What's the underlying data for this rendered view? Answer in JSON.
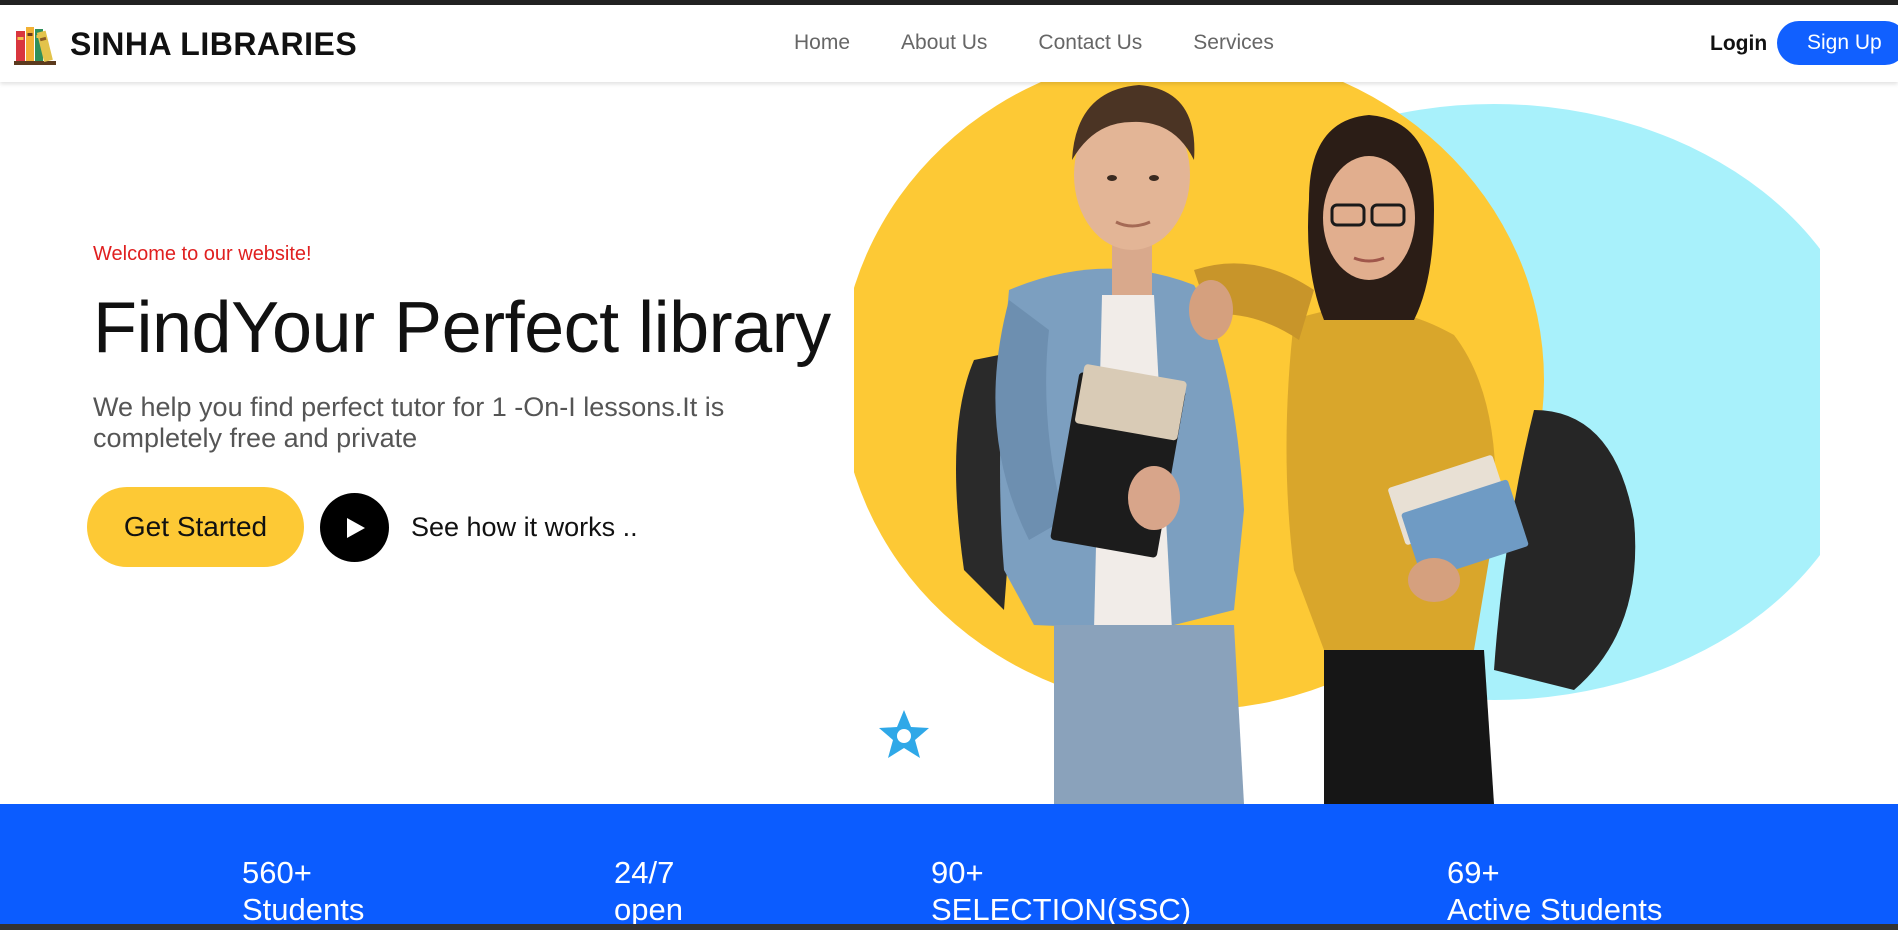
{
  "brand": {
    "name": "SINHA LIBRARIES",
    "logo_icon": "books-icon"
  },
  "nav": {
    "links": [
      "Home",
      "About Us",
      "Contact Us",
      "Services"
    ],
    "login_label": "Login",
    "signup_label": "Sign Up"
  },
  "hero": {
    "welcome": "Welcome to our website!",
    "title": "FindYour Perfect library",
    "description": "We help you find perfect tutor for 1 -On-I lessons.It is completely free and private",
    "cta_label": "Get Started",
    "play_icon": "play-icon",
    "secondary_label": "See how it works .."
  },
  "colors": {
    "accent_yellow": "#fdc935",
    "accent_blue": "#0b5cff",
    "welcome_red": "#e02020",
    "circle_cyan": "#a8f1fb"
  },
  "stats": [
    {
      "number": "560+",
      "label": "Students"
    },
    {
      "number": "24/7",
      "label": "open"
    },
    {
      "number": "90+",
      "label": "SELECTION(SSC)"
    },
    {
      "number": "69+",
      "label": "Active Students"
    }
  ]
}
